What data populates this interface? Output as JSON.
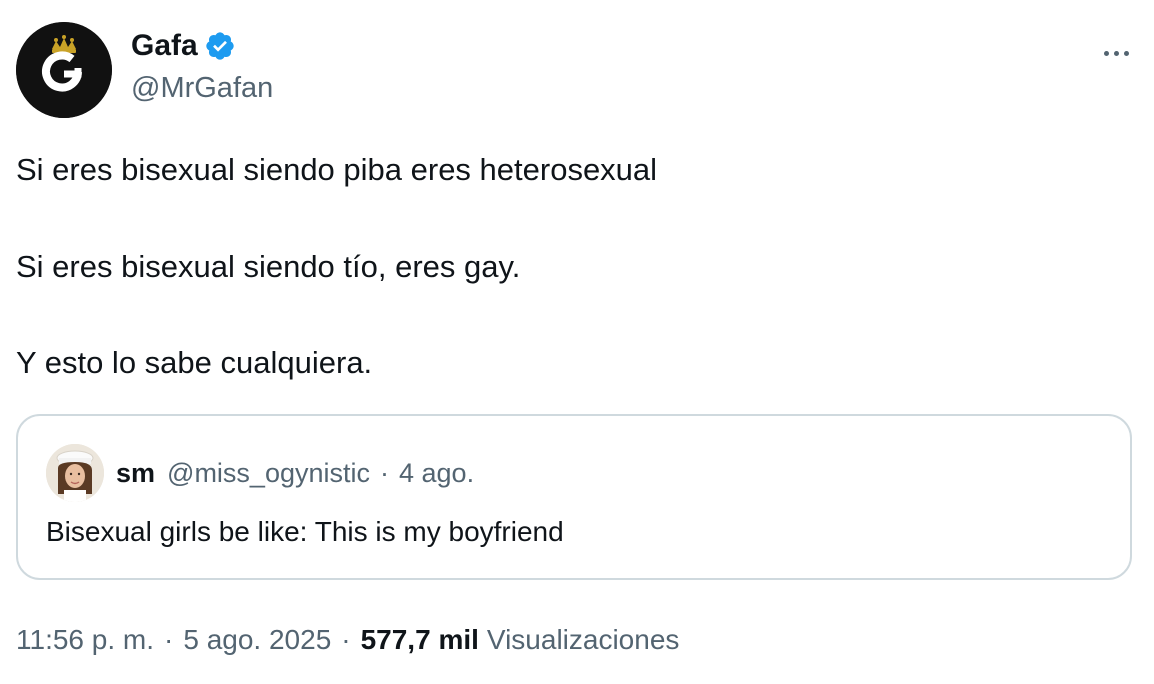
{
  "author": {
    "display_name": "Gafa",
    "handle": "@MrGafan",
    "verified": true,
    "avatar_icon": "crowned-g-logo-icon"
  },
  "tweet": {
    "lines": [
      "Si eres bisexual siendo piba eres heterosexual",
      "Si eres bisexual siendo tío, eres gay.",
      "Y esto lo sabe cualquiera."
    ]
  },
  "quote": {
    "display_name": "sm",
    "handle": "@miss_ogynistic",
    "separator": "·",
    "date": "4 ago.",
    "text": "Bisexual girls be like: This is my boyfriend"
  },
  "meta": {
    "time": "11:56 p. m.",
    "separator": "·",
    "date": "5 ago. 2025",
    "views_count": "577,7 mil",
    "views_label": "Visualizaciones"
  },
  "colors": {
    "text_primary": "#0f1419",
    "text_secondary": "#536471",
    "verified_blue": "#1d9bf0",
    "border": "#cfd9de"
  }
}
